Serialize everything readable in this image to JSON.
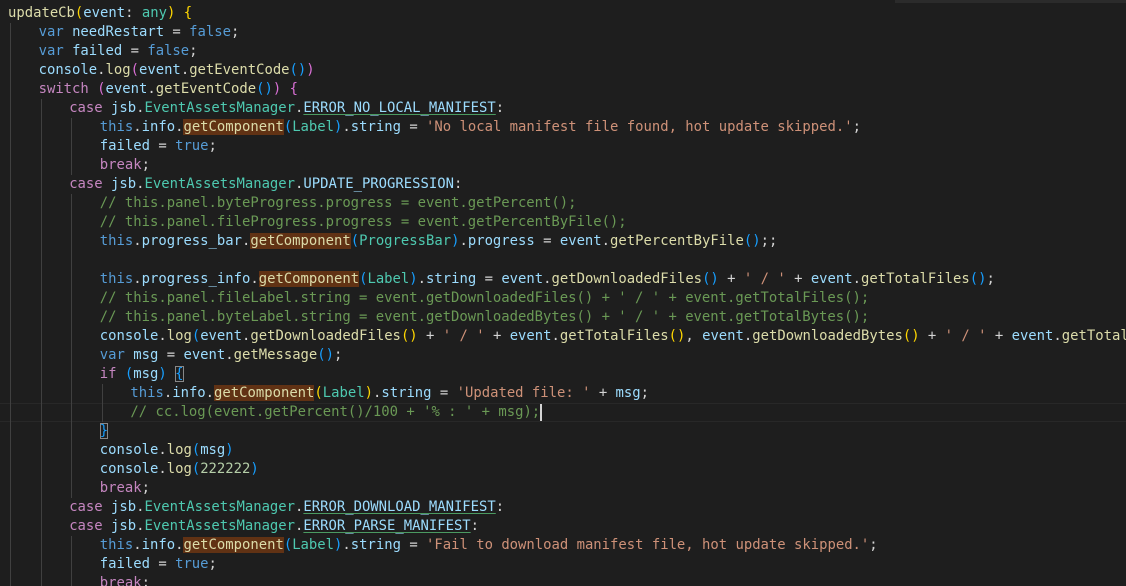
{
  "editor": {
    "language": "typescript",
    "cursor_line": 21,
    "lines": [
      {
        "indent": 0,
        "tokens": [
          {
            "t": "updateCb",
            "c": "f"
          },
          {
            "t": "(",
            "c": "b1"
          },
          {
            "t": "event",
            "c": "v"
          },
          {
            "t": ": ",
            "c": "p"
          },
          {
            "t": "any",
            "c": "c"
          },
          {
            "t": ")",
            "c": "b1"
          },
          {
            "t": " ",
            "c": "p"
          },
          {
            "t": "{",
            "c": "b1"
          }
        ]
      },
      {
        "indent": 1,
        "tokens": [
          {
            "t": "var",
            "c": "k"
          },
          {
            "t": " ",
            "c": "p"
          },
          {
            "t": "needRestart",
            "c": "v"
          },
          {
            "t": " = ",
            "c": "p"
          },
          {
            "t": "false",
            "c": "k"
          },
          {
            "t": ";",
            "c": "p"
          }
        ]
      },
      {
        "indent": 1,
        "tokens": [
          {
            "t": "var",
            "c": "k"
          },
          {
            "t": " ",
            "c": "p"
          },
          {
            "t": "failed",
            "c": "v"
          },
          {
            "t": " = ",
            "c": "p"
          },
          {
            "t": "false",
            "c": "k"
          },
          {
            "t": ";",
            "c": "p"
          }
        ]
      },
      {
        "indent": 1,
        "tokens": [
          {
            "t": "console",
            "c": "v"
          },
          {
            "t": ".",
            "c": "p"
          },
          {
            "t": "log",
            "c": "f"
          },
          {
            "t": "(",
            "c": "b2"
          },
          {
            "t": "event",
            "c": "v"
          },
          {
            "t": ".",
            "c": "p"
          },
          {
            "t": "getEventCode",
            "c": "f"
          },
          {
            "t": "()",
            "c": "b3"
          },
          {
            "t": ")",
            "c": "b2"
          }
        ]
      },
      {
        "indent": 1,
        "tokens": [
          {
            "t": "switch",
            "c": "ctl"
          },
          {
            "t": " ",
            "c": "p"
          },
          {
            "t": "(",
            "c": "b2"
          },
          {
            "t": "event",
            "c": "v"
          },
          {
            "t": ".",
            "c": "p"
          },
          {
            "t": "getEventCode",
            "c": "f"
          },
          {
            "t": "()",
            "c": "b3"
          },
          {
            "t": ")",
            "c": "b2"
          },
          {
            "t": " ",
            "c": "p"
          },
          {
            "t": "{",
            "c": "b2"
          }
        ]
      },
      {
        "indent": 2,
        "tokens": [
          {
            "t": "case",
            "c": "ctl"
          },
          {
            "t": " ",
            "c": "p"
          },
          {
            "t": "jsb",
            "c": "v"
          },
          {
            "t": ".",
            "c": "p"
          },
          {
            "t": "EventAssetsManager",
            "c": "c"
          },
          {
            "t": ".",
            "c": "p"
          },
          {
            "t": "ERROR_NO_LOCAL_MANIFEST",
            "c": "v u"
          },
          {
            "t": ":",
            "c": "p"
          }
        ]
      },
      {
        "indent": 3,
        "tokens": [
          {
            "t": "this",
            "c": "k"
          },
          {
            "t": ".",
            "c": "p"
          },
          {
            "t": "info",
            "c": "v"
          },
          {
            "t": ".",
            "c": "p"
          },
          {
            "t": "getComponent",
            "c": "f hl"
          },
          {
            "t": "(",
            "c": "b3"
          },
          {
            "t": "Label",
            "c": "c"
          },
          {
            "t": ")",
            "c": "b3"
          },
          {
            "t": ".",
            "c": "p"
          },
          {
            "t": "string",
            "c": "v"
          },
          {
            "t": " = ",
            "c": "p"
          },
          {
            "t": "'No local manifest file found, hot update skipped.'",
            "c": "s"
          },
          {
            "t": ";",
            "c": "p"
          }
        ]
      },
      {
        "indent": 3,
        "tokens": [
          {
            "t": "failed",
            "c": "v"
          },
          {
            "t": " = ",
            "c": "p"
          },
          {
            "t": "true",
            "c": "k"
          },
          {
            "t": ";",
            "c": "p"
          }
        ]
      },
      {
        "indent": 3,
        "tokens": [
          {
            "t": "break",
            "c": "ctl"
          },
          {
            "t": ";",
            "c": "p"
          }
        ]
      },
      {
        "indent": 2,
        "tokens": [
          {
            "t": "case",
            "c": "ctl"
          },
          {
            "t": " ",
            "c": "p"
          },
          {
            "t": "jsb",
            "c": "v"
          },
          {
            "t": ".",
            "c": "p"
          },
          {
            "t": "EventAssetsManager",
            "c": "c"
          },
          {
            "t": ".",
            "c": "p"
          },
          {
            "t": "UPDATE_PROGRESSION",
            "c": "v"
          },
          {
            "t": ":",
            "c": "p"
          }
        ]
      },
      {
        "indent": 3,
        "tokens": [
          {
            "t": "// this.panel.byteProgress.progress = event.getPercent();",
            "c": "m"
          }
        ]
      },
      {
        "indent": 3,
        "tokens": [
          {
            "t": "// this.panel.fileProgress.progress = event.getPercentByFile();",
            "c": "m"
          }
        ]
      },
      {
        "indent": 3,
        "tokens": [
          {
            "t": "this",
            "c": "k"
          },
          {
            "t": ".",
            "c": "p"
          },
          {
            "t": "progress_bar",
            "c": "v"
          },
          {
            "t": ".",
            "c": "p"
          },
          {
            "t": "getComponent",
            "c": "f hl"
          },
          {
            "t": "(",
            "c": "b3"
          },
          {
            "t": "ProgressBar",
            "c": "c"
          },
          {
            "t": ")",
            "c": "b3"
          },
          {
            "t": ".",
            "c": "p"
          },
          {
            "t": "progress",
            "c": "v"
          },
          {
            "t": " = ",
            "c": "p"
          },
          {
            "t": "event",
            "c": "v"
          },
          {
            "t": ".",
            "c": "p"
          },
          {
            "t": "getPercentByFile",
            "c": "f"
          },
          {
            "t": "()",
            "c": "b3"
          },
          {
            "t": ";;",
            "c": "p"
          }
        ]
      },
      {
        "indent": 3,
        "tokens": []
      },
      {
        "indent": 3,
        "tokens": [
          {
            "t": "this",
            "c": "k"
          },
          {
            "t": ".",
            "c": "p"
          },
          {
            "t": "progress_info",
            "c": "v"
          },
          {
            "t": ".",
            "c": "p"
          },
          {
            "t": "getComponent",
            "c": "f hl"
          },
          {
            "t": "(",
            "c": "b3"
          },
          {
            "t": "Label",
            "c": "c"
          },
          {
            "t": ")",
            "c": "b3"
          },
          {
            "t": ".",
            "c": "p"
          },
          {
            "t": "string",
            "c": "v"
          },
          {
            "t": " = ",
            "c": "p"
          },
          {
            "t": "event",
            "c": "v"
          },
          {
            "t": ".",
            "c": "p"
          },
          {
            "t": "getDownloadedFiles",
            "c": "f"
          },
          {
            "t": "()",
            "c": "b3"
          },
          {
            "t": " + ",
            "c": "p"
          },
          {
            "t": "' / '",
            "c": "s"
          },
          {
            "t": " + ",
            "c": "p"
          },
          {
            "t": "event",
            "c": "v"
          },
          {
            "t": ".",
            "c": "p"
          },
          {
            "t": "getTotalFiles",
            "c": "f"
          },
          {
            "t": "()",
            "c": "b3"
          },
          {
            "t": ";",
            "c": "p"
          }
        ]
      },
      {
        "indent": 3,
        "tokens": [
          {
            "t": "// this.panel.fileLabel.string = event.getDownloadedFiles() + ' / ' + event.getTotalFiles();",
            "c": "m"
          }
        ]
      },
      {
        "indent": 3,
        "tokens": [
          {
            "t": "// this.panel.byteLabel.string = event.getDownloadedBytes() + ' / ' + event.getTotalBytes();",
            "c": "m"
          }
        ]
      },
      {
        "indent": 3,
        "tokens": [
          {
            "t": "console",
            "c": "v"
          },
          {
            "t": ".",
            "c": "p"
          },
          {
            "t": "log",
            "c": "f"
          },
          {
            "t": "(",
            "c": "b3"
          },
          {
            "t": "event",
            "c": "v"
          },
          {
            "t": ".",
            "c": "p"
          },
          {
            "t": "getDownloadedFiles",
            "c": "f"
          },
          {
            "t": "()",
            "c": "b1"
          },
          {
            "t": " + ",
            "c": "p"
          },
          {
            "t": "' / '",
            "c": "s"
          },
          {
            "t": " + ",
            "c": "p"
          },
          {
            "t": "event",
            "c": "v"
          },
          {
            "t": ".",
            "c": "p"
          },
          {
            "t": "getTotalFiles",
            "c": "f"
          },
          {
            "t": "()",
            "c": "b1"
          },
          {
            "t": ", ",
            "c": "p"
          },
          {
            "t": "event",
            "c": "v"
          },
          {
            "t": ".",
            "c": "p"
          },
          {
            "t": "getDownloadedBytes",
            "c": "f"
          },
          {
            "t": "()",
            "c": "b1"
          },
          {
            "t": " + ",
            "c": "p"
          },
          {
            "t": "' / '",
            "c": "s"
          },
          {
            "t": " + ",
            "c": "p"
          },
          {
            "t": "event",
            "c": "v"
          },
          {
            "t": ".",
            "c": "p"
          },
          {
            "t": "getTotalBytes",
            "c": "f"
          },
          {
            "t": "()",
            "c": "b1"
          },
          {
            "t": ")",
            "c": "b3"
          },
          {
            "t": ";",
            "c": "p"
          }
        ]
      },
      {
        "indent": 3,
        "tokens": [
          {
            "t": "var",
            "c": "k"
          },
          {
            "t": " ",
            "c": "p"
          },
          {
            "t": "msg",
            "c": "v"
          },
          {
            "t": " = ",
            "c": "p"
          },
          {
            "t": "event",
            "c": "v"
          },
          {
            "t": ".",
            "c": "p"
          },
          {
            "t": "getMessage",
            "c": "f"
          },
          {
            "t": "()",
            "c": "b3"
          },
          {
            "t": ";",
            "c": "p"
          }
        ]
      },
      {
        "indent": 3,
        "tokens": [
          {
            "t": "if",
            "c": "ctl"
          },
          {
            "t": " ",
            "c": "p"
          },
          {
            "t": "(",
            "c": "b3"
          },
          {
            "t": "msg",
            "c": "v"
          },
          {
            "t": ")",
            "c": "b3"
          },
          {
            "t": " ",
            "c": "p"
          },
          {
            "t": "{",
            "c": "b3 bm"
          }
        ]
      },
      {
        "indent": 4,
        "tokens": [
          {
            "t": "this",
            "c": "k"
          },
          {
            "t": ".",
            "c": "p"
          },
          {
            "t": "info",
            "c": "v"
          },
          {
            "t": ".",
            "c": "p"
          },
          {
            "t": "getComponent",
            "c": "f hl"
          },
          {
            "t": "(",
            "c": "b1"
          },
          {
            "t": "Label",
            "c": "c"
          },
          {
            "t": ")",
            "c": "b1"
          },
          {
            "t": ".",
            "c": "p"
          },
          {
            "t": "string",
            "c": "v"
          },
          {
            "t": " = ",
            "c": "p"
          },
          {
            "t": "'Updated file: '",
            "c": "s"
          },
          {
            "t": " + ",
            "c": "p"
          },
          {
            "t": "msg",
            "c": "v"
          },
          {
            "t": ";",
            "c": "p"
          }
        ]
      },
      {
        "indent": 4,
        "tokens": [
          {
            "t": "// cc.log(event.getPercent()/100 + '% : ' + msg);",
            "c": "m"
          }
        ]
      },
      {
        "indent": 3,
        "tokens": [
          {
            "t": "}",
            "c": "b3 bm"
          }
        ]
      },
      {
        "indent": 3,
        "tokens": [
          {
            "t": "console",
            "c": "v"
          },
          {
            "t": ".",
            "c": "p"
          },
          {
            "t": "log",
            "c": "f"
          },
          {
            "t": "(",
            "c": "b3"
          },
          {
            "t": "msg",
            "c": "v"
          },
          {
            "t": ")",
            "c": "b3"
          }
        ]
      },
      {
        "indent": 3,
        "tokens": [
          {
            "t": "console",
            "c": "v"
          },
          {
            "t": ".",
            "c": "p"
          },
          {
            "t": "log",
            "c": "f"
          },
          {
            "t": "(",
            "c": "b3"
          },
          {
            "t": "222222",
            "c": "n"
          },
          {
            "t": ")",
            "c": "b3"
          }
        ]
      },
      {
        "indent": 3,
        "tokens": [
          {
            "t": "break",
            "c": "ctl"
          },
          {
            "t": ";",
            "c": "p"
          }
        ]
      },
      {
        "indent": 2,
        "tokens": [
          {
            "t": "case",
            "c": "ctl"
          },
          {
            "t": " ",
            "c": "p"
          },
          {
            "t": "jsb",
            "c": "v"
          },
          {
            "t": ".",
            "c": "p"
          },
          {
            "t": "EventAssetsManager",
            "c": "c"
          },
          {
            "t": ".",
            "c": "p"
          },
          {
            "t": "ERROR_DOWNLOAD_MANIFEST",
            "c": "v u"
          },
          {
            "t": ":",
            "c": "p"
          }
        ]
      },
      {
        "indent": 2,
        "tokens": [
          {
            "t": "case",
            "c": "ctl"
          },
          {
            "t": " ",
            "c": "p"
          },
          {
            "t": "jsb",
            "c": "v"
          },
          {
            "t": ".",
            "c": "p"
          },
          {
            "t": "EventAssetsManager",
            "c": "c"
          },
          {
            "t": ".",
            "c": "p"
          },
          {
            "t": "ERROR_PARSE_MANIFEST",
            "c": "v u"
          },
          {
            "t": ":",
            "c": "p"
          }
        ]
      },
      {
        "indent": 3,
        "tokens": [
          {
            "t": "this",
            "c": "k"
          },
          {
            "t": ".",
            "c": "p"
          },
          {
            "t": "info",
            "c": "v"
          },
          {
            "t": ".",
            "c": "p"
          },
          {
            "t": "getComponent",
            "c": "f hl"
          },
          {
            "t": "(",
            "c": "b3"
          },
          {
            "t": "Label",
            "c": "c"
          },
          {
            "t": ")",
            "c": "b3"
          },
          {
            "t": ".",
            "c": "p"
          },
          {
            "t": "string",
            "c": "v"
          },
          {
            "t": " = ",
            "c": "p"
          },
          {
            "t": "'Fail to download manifest file, hot update skipped.'",
            "c": "s"
          },
          {
            "t": ";",
            "c": "p"
          }
        ]
      },
      {
        "indent": 3,
        "tokens": [
          {
            "t": "failed",
            "c": "v"
          },
          {
            "t": " = ",
            "c": "p"
          },
          {
            "t": "true",
            "c": "k"
          },
          {
            "t": ";",
            "c": "p"
          }
        ]
      },
      {
        "indent": 3,
        "tokens": [
          {
            "t": "break",
            "c": "ctl"
          },
          {
            "t": ";",
            "c": "p"
          }
        ]
      }
    ]
  }
}
